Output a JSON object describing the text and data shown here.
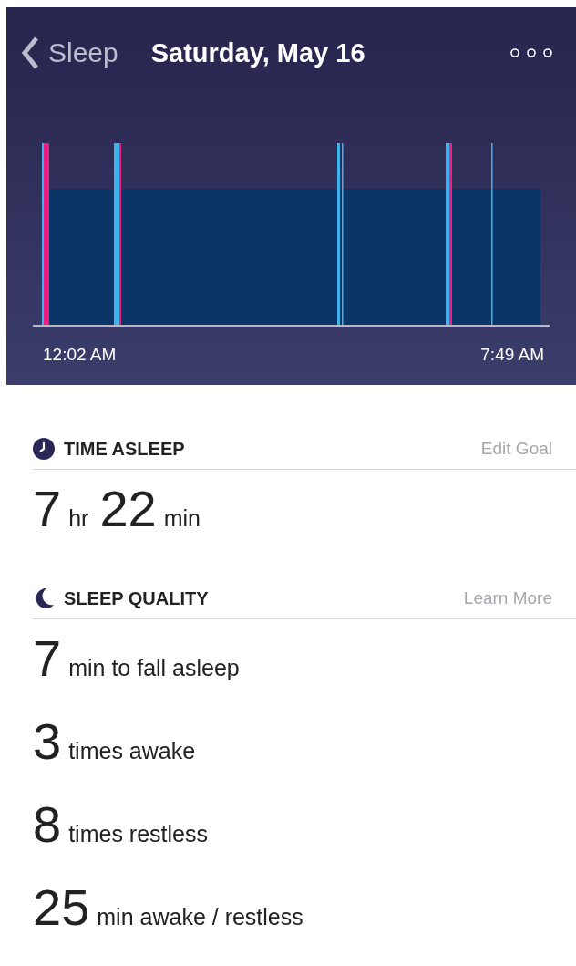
{
  "nav": {
    "back_label": "Sleep",
    "title": "Saturday, May 16"
  },
  "chart": {
    "start_label": "12:02 AM",
    "end_label": "7:49 AM"
  },
  "sections": [
    {
      "kind": "duration",
      "title": "TIME ASLEEP",
      "action": "Edit Goal",
      "values": [
        {
          "number": "7",
          "unit": "hr"
        },
        {
          "number": "22",
          "unit": "min"
        }
      ]
    },
    {
      "kind": "stats",
      "title": "SLEEP QUALITY",
      "action": "Learn More",
      "rows": [
        {
          "number": "7",
          "label": "min to fall asleep"
        },
        {
          "number": "3",
          "label": "times awake"
        },
        {
          "number": "8",
          "label": "times restless"
        },
        {
          "number": "25",
          "label": "min awake / restless"
        }
      ]
    }
  ]
}
